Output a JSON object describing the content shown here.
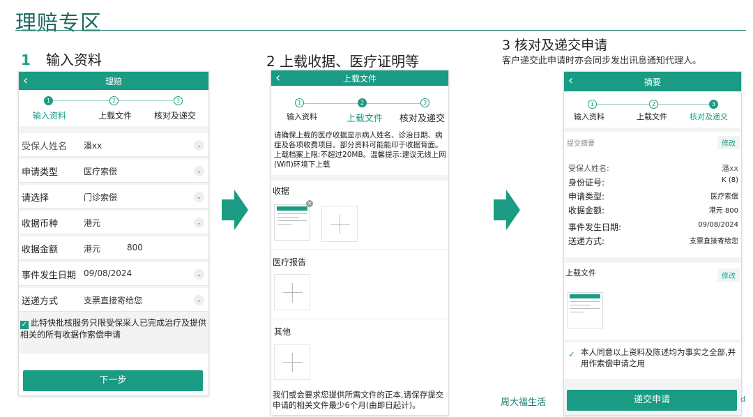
{
  "page": {
    "title": "理赔专区"
  },
  "step1": {
    "number": "1",
    "heading": "输入资料",
    "appbar_title": "理赔",
    "stepper": [
      {
        "num": "1",
        "label": "输入资料"
      },
      {
        "num": "2",
        "label": "上载文件"
      },
      {
        "num": "3",
        "label": "核对及递交"
      }
    ],
    "fields": [
      {
        "label": "受保人姓名",
        "value": "潘xx",
        "value2": ""
      },
      {
        "label": "申请类型",
        "value": "医疗索偿",
        "value2": ""
      },
      {
        "label": "请选择",
        "value": "门诊索偿",
        "value2": ""
      },
      {
        "label": "收据币种",
        "value": "港元",
        "value2": ""
      },
      {
        "label": "收据金额",
        "value": "港元",
        "value2": "800"
      },
      {
        "label": "事件发生日期",
        "value": "09/08/2024",
        "value2": ""
      },
      {
        "label": "送递方式",
        "value": "支票直接寄给您",
        "value2": ""
      }
    ],
    "declaration": "此特快批核服务只限受保采人已完成治疗及提供相关的所有收据作索偿申请",
    "next_button": "下一步"
  },
  "step2": {
    "heading": "2 上载收据、医疗证明等",
    "appbar_title": "上载文件",
    "stepper": [
      {
        "num": "1",
        "label": "输入资料"
      },
      {
        "num": "2",
        "label": "上载文件"
      },
      {
        "num": "3",
        "label": "核对及递交"
      }
    ],
    "notice": "请确保上载的医疗收据显示病人姓名、诊治日期、病症及各项收费项目。部分资料可能能印于收据背面。上载档案上限:不超过20MB。温馨提示:建议无线上网(Wifi)环境下上载",
    "section_receipt": "收据",
    "section_medical": "医疗报告",
    "section_other": "其他",
    "footer_note": "我们或会要求您提供所需文件的正本,请保存提交申请的相关文件最少6个月(由即日起计)。"
  },
  "step3": {
    "heading": "3 核对及递交申请",
    "subheading": "客户递交此申请时亦会同步发出讯息通知代理人。",
    "appbar_title": "摘要",
    "stepper": [
      {
        "num": "1",
        "label": "输入资料"
      },
      {
        "num": "2",
        "label": "上载文件"
      },
      {
        "num": "3",
        "label": "核对及递交"
      }
    ],
    "summary_title": "提交摘要",
    "edit_label": "修改",
    "summary_rows": [
      {
        "label": "受保人姓名:",
        "value": "潘xx"
      },
      {
        "label": "身份证号:",
        "value": "K        (8)"
      },
      {
        "label": "申请类型:",
        "value": "医疗索偿"
      },
      {
        "label": "收据金额:",
        "value": "港元 800"
      },
      {
        "label": "事件发生日期:",
        "value": "09/08/2024"
      },
      {
        "label": "送递方式:",
        "value": "支票直接寄给您"
      }
    ],
    "uploads_title": "上载文件",
    "agreement": "本人同意以上资料及陈述均为事实之全部,并用作索偿申请之用",
    "submit_button": "递交申请",
    "brand": "周大福生活",
    "corner_mark": "d"
  },
  "colors": {
    "accent": "#1a9b83",
    "title": "#1e6b60"
  }
}
